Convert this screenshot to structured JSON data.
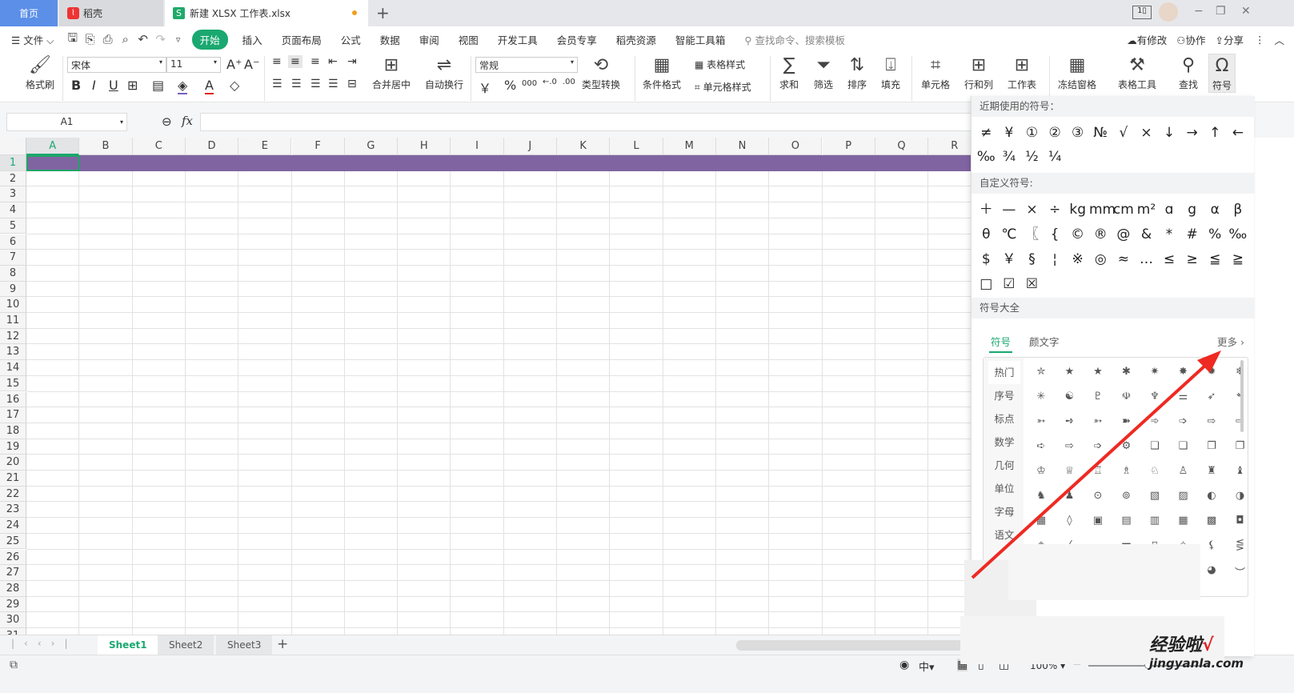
{
  "tabs": {
    "home": "首页",
    "daoke": "稻壳",
    "file": "新建 XLSX 工作表.xlsx",
    "new_tab": "+"
  },
  "window": {
    "ctrl_min": "−",
    "ctrl_max": "❐",
    "ctrl_close": "✕"
  },
  "menu": {
    "file": "文件",
    "items": [
      "开始",
      "插入",
      "页面布局",
      "公式",
      "数据",
      "审阅",
      "视图",
      "开发工具",
      "会员专享",
      "稻壳资源",
      "智能工具箱"
    ],
    "search_placeholder": "查找命令、搜索模板",
    "modified": "有修改",
    "collab": "协作",
    "share": "分享"
  },
  "ribbon": {
    "format_painter": "格式刷",
    "font": "宋体",
    "size": "11",
    "number_format": "常规",
    "merge": "合并居中",
    "wrap": "自动换行",
    "convert": "类型转换",
    "cond_format": "条件格式",
    "table_style": "表格样式",
    "cell_style": "单元格样式",
    "sum": "求和",
    "filter": "筛选",
    "sort": "排序",
    "fill": "填充",
    "cell": "单元格",
    "rowcol": "行和列",
    "sheet": "工作表",
    "freeze": "冻结窗格",
    "table_tools": "表格工具",
    "find": "查找",
    "symbol": "符号"
  },
  "formula": {
    "cell_ref": "A1",
    "fx": "fx",
    "value": ""
  },
  "grid": {
    "columns": [
      "A",
      "B",
      "C",
      "D",
      "E",
      "F",
      "G",
      "H",
      "I",
      "J",
      "K",
      "L",
      "M",
      "N",
      "O",
      "P",
      "Q",
      "R"
    ],
    "rows": [
      "1",
      "2",
      "3",
      "4",
      "5",
      "6",
      "7",
      "8",
      "9",
      "10",
      "11",
      "12",
      "13",
      "14",
      "15",
      "16",
      "17",
      "18",
      "19",
      "20",
      "21",
      "22",
      "23",
      "24",
      "25",
      "26",
      "27",
      "28",
      "29",
      "30",
      "31"
    ],
    "row1_fill": "#8064a2",
    "selected": "A1"
  },
  "sheets": {
    "tabs": [
      "Sheet1",
      "Sheet2",
      "Sheet3"
    ],
    "active": "Sheet1",
    "add": "+"
  },
  "status": {
    "zoom": "100%"
  },
  "panel": {
    "recent_title": "近期使用的符号：",
    "recent": [
      "≠",
      "¥",
      "①",
      "②",
      "③",
      "№",
      "√",
      "×",
      "↓",
      "→",
      "↑",
      "←",
      "‰",
      "¾",
      "½",
      "¼"
    ],
    "custom_title": "自定义符号:",
    "custom": [
      "＋",
      "—",
      "×",
      "÷",
      "kg",
      "mm",
      "cm",
      "m²",
      "ɑ",
      "g",
      "α",
      "β",
      "θ",
      "℃",
      "〖",
      "{",
      "©",
      "®",
      "@",
      "&",
      "*",
      "#",
      "%",
      "‰",
      "$",
      "￥",
      "§",
      "¦",
      "※",
      "◎",
      "≈",
      "…",
      "≤",
      "≥",
      "≦",
      "≧",
      "□",
      "☑",
      "☒"
    ],
    "all_title": "符号大全",
    "tab_symbol": "符号",
    "tab_kaomoji": "颜文字",
    "more": "更多",
    "categories": [
      "热门",
      "序号",
      "标点",
      "数学",
      "几何",
      "单位",
      "字母",
      "语文"
    ],
    "symbols": [
      "✮",
      "★",
      "★",
      "✱",
      "✷",
      "✸",
      "✹",
      "❄",
      "✳",
      "☯",
      "♇",
      "☫",
      "♆",
      "⚌",
      "➶",
      "➴",
      "➳",
      "➺",
      "➳",
      "➽",
      "➾",
      "➩",
      "⇨",
      "⇨",
      "➪",
      "⇨",
      "➩",
      "⚙",
      "❑",
      "❑",
      "❐",
      "❐",
      "♔",
      "♕",
      "♖",
      "♗",
      "♘",
      "♙",
      "♜",
      "♝",
      "♞",
      "♟",
      "⊙",
      "⊚",
      "▧",
      "▨",
      "◐",
      "◑",
      "▦",
      "◊",
      "▣",
      "▤",
      "▥",
      "▦",
      "▩",
      "◘",
      "◈",
      "⁄",
      "",
      "〓",
      "⌑",
      "✧",
      "⚸",
      "⋚",
      "",
      "",
      "",
      "",
      "",
      "",
      "◕",
      "︶"
    ]
  },
  "watermark": {
    "text": "经验啦",
    "url": "jingyanla.com",
    "check": "√"
  },
  "colors": {
    "accent": "#1aa870",
    "home_tab": "#5b8fe8",
    "arrow": "#ee2a22"
  }
}
